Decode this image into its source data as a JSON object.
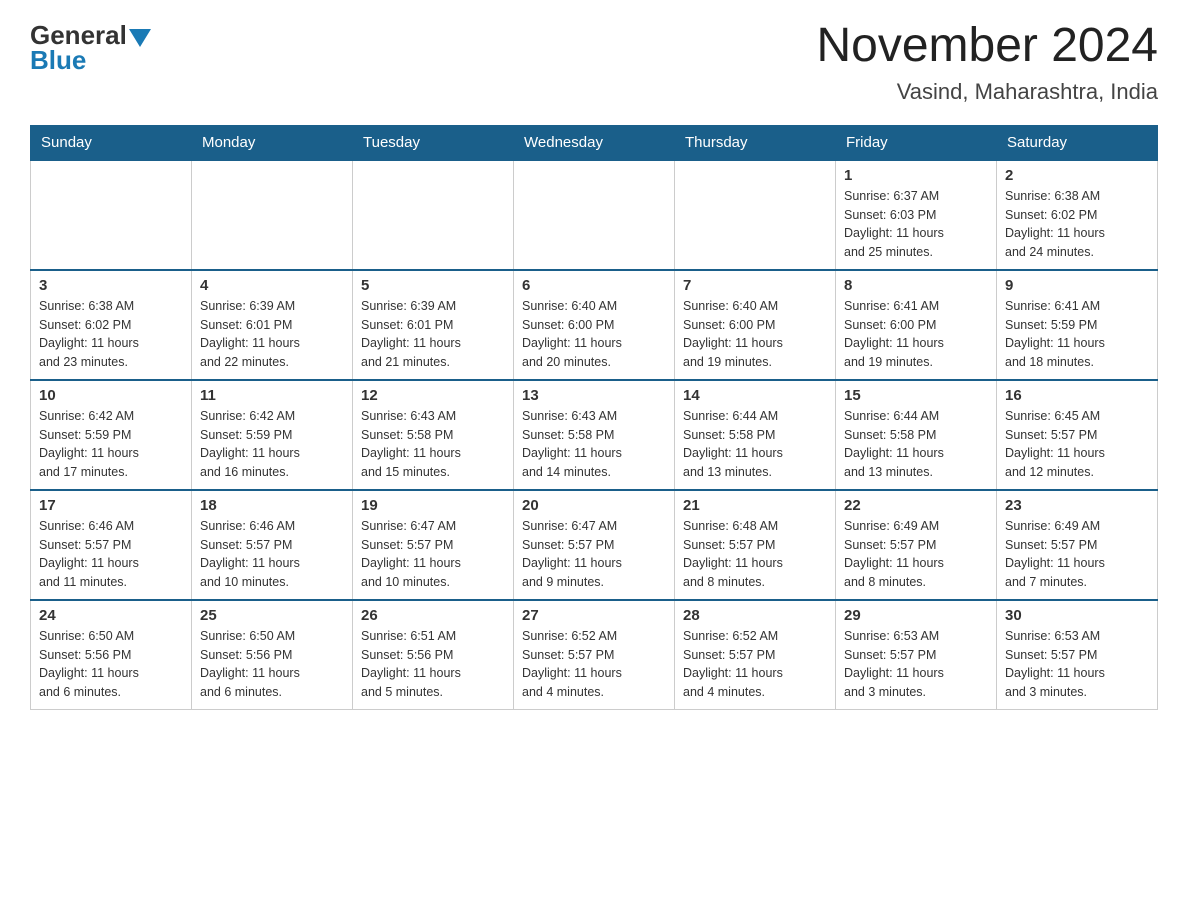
{
  "header": {
    "logo_general": "General",
    "logo_blue": "Blue",
    "month_title": "November 2024",
    "location": "Vasind, Maharashtra, India"
  },
  "days_of_week": [
    "Sunday",
    "Monday",
    "Tuesday",
    "Wednesday",
    "Thursday",
    "Friday",
    "Saturday"
  ],
  "weeks": [
    [
      {
        "day": "",
        "info": ""
      },
      {
        "day": "",
        "info": ""
      },
      {
        "day": "",
        "info": ""
      },
      {
        "day": "",
        "info": ""
      },
      {
        "day": "",
        "info": ""
      },
      {
        "day": "1",
        "info": "Sunrise: 6:37 AM\nSunset: 6:03 PM\nDaylight: 11 hours\nand 25 minutes."
      },
      {
        "day": "2",
        "info": "Sunrise: 6:38 AM\nSunset: 6:02 PM\nDaylight: 11 hours\nand 24 minutes."
      }
    ],
    [
      {
        "day": "3",
        "info": "Sunrise: 6:38 AM\nSunset: 6:02 PM\nDaylight: 11 hours\nand 23 minutes."
      },
      {
        "day": "4",
        "info": "Sunrise: 6:39 AM\nSunset: 6:01 PM\nDaylight: 11 hours\nand 22 minutes."
      },
      {
        "day": "5",
        "info": "Sunrise: 6:39 AM\nSunset: 6:01 PM\nDaylight: 11 hours\nand 21 minutes."
      },
      {
        "day": "6",
        "info": "Sunrise: 6:40 AM\nSunset: 6:00 PM\nDaylight: 11 hours\nand 20 minutes."
      },
      {
        "day": "7",
        "info": "Sunrise: 6:40 AM\nSunset: 6:00 PM\nDaylight: 11 hours\nand 19 minutes."
      },
      {
        "day": "8",
        "info": "Sunrise: 6:41 AM\nSunset: 6:00 PM\nDaylight: 11 hours\nand 19 minutes."
      },
      {
        "day": "9",
        "info": "Sunrise: 6:41 AM\nSunset: 5:59 PM\nDaylight: 11 hours\nand 18 minutes."
      }
    ],
    [
      {
        "day": "10",
        "info": "Sunrise: 6:42 AM\nSunset: 5:59 PM\nDaylight: 11 hours\nand 17 minutes."
      },
      {
        "day": "11",
        "info": "Sunrise: 6:42 AM\nSunset: 5:59 PM\nDaylight: 11 hours\nand 16 minutes."
      },
      {
        "day": "12",
        "info": "Sunrise: 6:43 AM\nSunset: 5:58 PM\nDaylight: 11 hours\nand 15 minutes."
      },
      {
        "day": "13",
        "info": "Sunrise: 6:43 AM\nSunset: 5:58 PM\nDaylight: 11 hours\nand 14 minutes."
      },
      {
        "day": "14",
        "info": "Sunrise: 6:44 AM\nSunset: 5:58 PM\nDaylight: 11 hours\nand 13 minutes."
      },
      {
        "day": "15",
        "info": "Sunrise: 6:44 AM\nSunset: 5:58 PM\nDaylight: 11 hours\nand 13 minutes."
      },
      {
        "day": "16",
        "info": "Sunrise: 6:45 AM\nSunset: 5:57 PM\nDaylight: 11 hours\nand 12 minutes."
      }
    ],
    [
      {
        "day": "17",
        "info": "Sunrise: 6:46 AM\nSunset: 5:57 PM\nDaylight: 11 hours\nand 11 minutes."
      },
      {
        "day": "18",
        "info": "Sunrise: 6:46 AM\nSunset: 5:57 PM\nDaylight: 11 hours\nand 10 minutes."
      },
      {
        "day": "19",
        "info": "Sunrise: 6:47 AM\nSunset: 5:57 PM\nDaylight: 11 hours\nand 10 minutes."
      },
      {
        "day": "20",
        "info": "Sunrise: 6:47 AM\nSunset: 5:57 PM\nDaylight: 11 hours\nand 9 minutes."
      },
      {
        "day": "21",
        "info": "Sunrise: 6:48 AM\nSunset: 5:57 PM\nDaylight: 11 hours\nand 8 minutes."
      },
      {
        "day": "22",
        "info": "Sunrise: 6:49 AM\nSunset: 5:57 PM\nDaylight: 11 hours\nand 8 minutes."
      },
      {
        "day": "23",
        "info": "Sunrise: 6:49 AM\nSunset: 5:57 PM\nDaylight: 11 hours\nand 7 minutes."
      }
    ],
    [
      {
        "day": "24",
        "info": "Sunrise: 6:50 AM\nSunset: 5:56 PM\nDaylight: 11 hours\nand 6 minutes."
      },
      {
        "day": "25",
        "info": "Sunrise: 6:50 AM\nSunset: 5:56 PM\nDaylight: 11 hours\nand 6 minutes."
      },
      {
        "day": "26",
        "info": "Sunrise: 6:51 AM\nSunset: 5:56 PM\nDaylight: 11 hours\nand 5 minutes."
      },
      {
        "day": "27",
        "info": "Sunrise: 6:52 AM\nSunset: 5:57 PM\nDaylight: 11 hours\nand 4 minutes."
      },
      {
        "day": "28",
        "info": "Sunrise: 6:52 AM\nSunset: 5:57 PM\nDaylight: 11 hours\nand 4 minutes."
      },
      {
        "day": "29",
        "info": "Sunrise: 6:53 AM\nSunset: 5:57 PM\nDaylight: 11 hours\nand 3 minutes."
      },
      {
        "day": "30",
        "info": "Sunrise: 6:53 AM\nSunset: 5:57 PM\nDaylight: 11 hours\nand 3 minutes."
      }
    ]
  ]
}
